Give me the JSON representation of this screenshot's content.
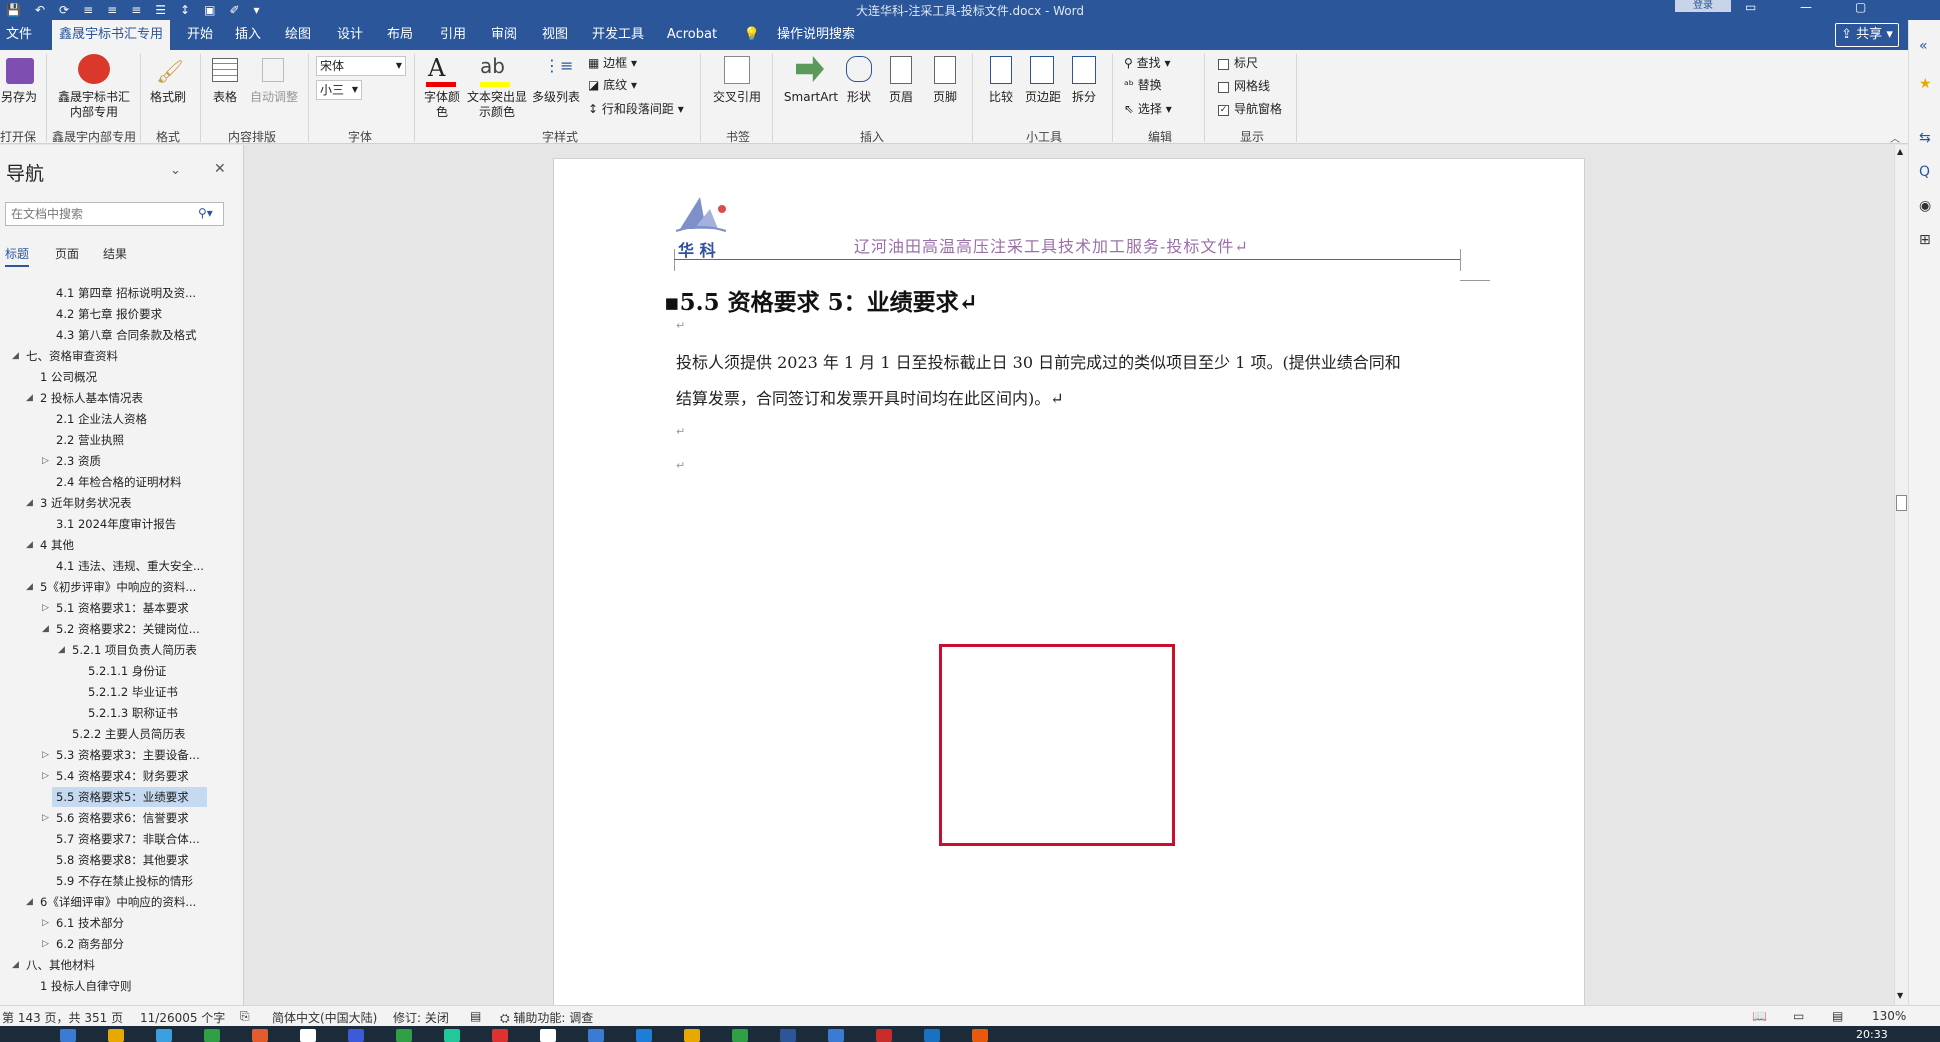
{
  "window": {
    "title": "大连华科-注采工具-投标文件.docx  -  Word",
    "login_label": "登录",
    "share_label": "共享"
  },
  "tabs": [
    "文件",
    "鑫晟宇标书汇专用",
    "开始",
    "插入",
    "绘图",
    "设计",
    "布局",
    "引用",
    "审阅",
    "视图",
    "开发工具",
    "Acrobat",
    "操作说明搜索"
  ],
  "ribbon": {
    "save_as": "另存为",
    "open_save": "打开保存",
    "xsy_button": "鑫晟宇标书汇内部专用",
    "xsy_group": "鑫晟宇内部专用",
    "format_painter": "格式刷",
    "format_group": "格式",
    "table": "表格",
    "auto_adjust": "自动调整",
    "content_group": "内容排版",
    "font_name": "宋体",
    "font_size": "小三",
    "font_group": "字体",
    "font_color": "字体颜色",
    "highlight": "文本突出显示颜色",
    "multilevel": "多级列表",
    "border": "边框",
    "shading": "底纹",
    "line_spacing": "行和段落间距",
    "style_group": "字样式",
    "cross_ref": "交叉引用",
    "bookmark_group": "书签",
    "smartart": "SmartArt",
    "shapes": "形状",
    "header": "页眉",
    "footer": "页脚",
    "insert_group": "插入",
    "compare": "比较",
    "margins": "页边距",
    "split": "拆分",
    "tools_group": "小工具",
    "find": "查找",
    "replace": "替换",
    "select": "选择",
    "edit_group": "编辑",
    "ruler": "标尺",
    "gridlines": "网格线",
    "nav_pane": "导航窗格",
    "show_group": "显示"
  },
  "nav": {
    "title": "导航",
    "search_placeholder": "在文档中搜索",
    "tabs": [
      "标题",
      "页面",
      "结果"
    ],
    "items": [
      {
        "text": "4.1 第四章  招标说明及资...",
        "level": 2,
        "tri": ""
      },
      {
        "text": "4.2 第七章  报价要求",
        "level": 2,
        "tri": ""
      },
      {
        "text": "4.3 第八章  合同条款及格式",
        "level": 2,
        "tri": ""
      },
      {
        "text": "七、资格审查资料",
        "level": 0,
        "tri": "◢"
      },
      {
        "text": "1 公司概况",
        "level": 1,
        "tri": ""
      },
      {
        "text": "2 投标人基本情况表",
        "level": 1,
        "tri": "◢"
      },
      {
        "text": "2.1 企业法人资格",
        "level": 2,
        "tri": ""
      },
      {
        "text": "2.2 营业执照",
        "level": 2,
        "tri": ""
      },
      {
        "text": "2.3 资质",
        "level": 2,
        "tri": "▷"
      },
      {
        "text": "2.4 年检合格的证明材料",
        "level": 2,
        "tri": ""
      },
      {
        "text": "3 近年财务状况表",
        "level": 1,
        "tri": "◢"
      },
      {
        "text": "3.1 2024年度审计报告",
        "level": 2,
        "tri": ""
      },
      {
        "text": "4 其他",
        "level": 1,
        "tri": "◢"
      },
      {
        "text": "4.1 违法、违规、重大安全...",
        "level": 2,
        "tri": ""
      },
      {
        "text": "5《初步评审》中响应的资料...",
        "level": 1,
        "tri": "◢"
      },
      {
        "text": "5.1 资格要求1：基本要求",
        "level": 2,
        "tri": "▷"
      },
      {
        "text": "5.2 资格要求2：关键岗位...",
        "level": 2,
        "tri": "◢"
      },
      {
        "text": "5.2.1 项目负责人简历表",
        "level": 3,
        "tri": "◢"
      },
      {
        "text": "5.2.1.1 身份证",
        "level": 4,
        "tri": ""
      },
      {
        "text": "5.2.1.2 毕业证书",
        "level": 4,
        "tri": ""
      },
      {
        "text": "5.2.1.3 职称证书",
        "level": 4,
        "tri": ""
      },
      {
        "text": "5.2.2 主要人员简历表",
        "level": 3,
        "tri": ""
      },
      {
        "text": "5.3 资格要求3：主要设备...",
        "level": 2,
        "tri": "▷"
      },
      {
        "text": "5.4 资格要求4：财务要求",
        "level": 2,
        "tri": "▷"
      },
      {
        "text": "5.5 资格要求5：业绩要求",
        "level": 2,
        "tri": "",
        "selected": true
      },
      {
        "text": "5.6 资格要求6：信誉要求",
        "level": 2,
        "tri": "▷"
      },
      {
        "text": "5.7 资格要求7：非联合体...",
        "level": 2,
        "tri": ""
      },
      {
        "text": "5.8 资格要求8：其他要求",
        "level": 2,
        "tri": ""
      },
      {
        "text": "5.9 不存在禁止投标的情形",
        "level": 2,
        "tri": ""
      },
      {
        "text": "6《详细评审》中响应的资料...",
        "level": 1,
        "tri": "◢"
      },
      {
        "text": "6.1 技术部分",
        "level": 2,
        "tri": "▷"
      },
      {
        "text": "6.2 商务部分",
        "level": 2,
        "tri": "▷"
      },
      {
        "text": "八、其他材料",
        "level": 0,
        "tri": "◢"
      },
      {
        "text": "1 投标人自律守则",
        "level": 1,
        "tri": ""
      }
    ]
  },
  "document": {
    "logo_text": "华 科",
    "header_text": "辽河油田高温高压注采工具技术加工服务-投标文件↵",
    "heading": "5.5 资格要求 5：业绩要求↵",
    "para_line1": "投标人须提供 2023 年 1 月 1 日至投标截止日 30 日前完成过的类似项目至少 1 项。(提供业绩合同和",
    "para_line2": "结算发票，合同签订和发票开具时间均在此区间内)。↵",
    "para_mark": "↵",
    "red_box_color": "#c8102e"
  },
  "status": {
    "page": "第 143 页，共 351 页",
    "words": "11/26005 个字",
    "language": "简体中文(中国大陆)",
    "track": "修订: 关闭",
    "accessibility": "辅助功能: 调查",
    "zoom": "130%"
  },
  "taskbar": {
    "clock": "20:33"
  },
  "colors": {
    "accent": "#2b579a",
    "header_purple": "#9b6fa8"
  }
}
